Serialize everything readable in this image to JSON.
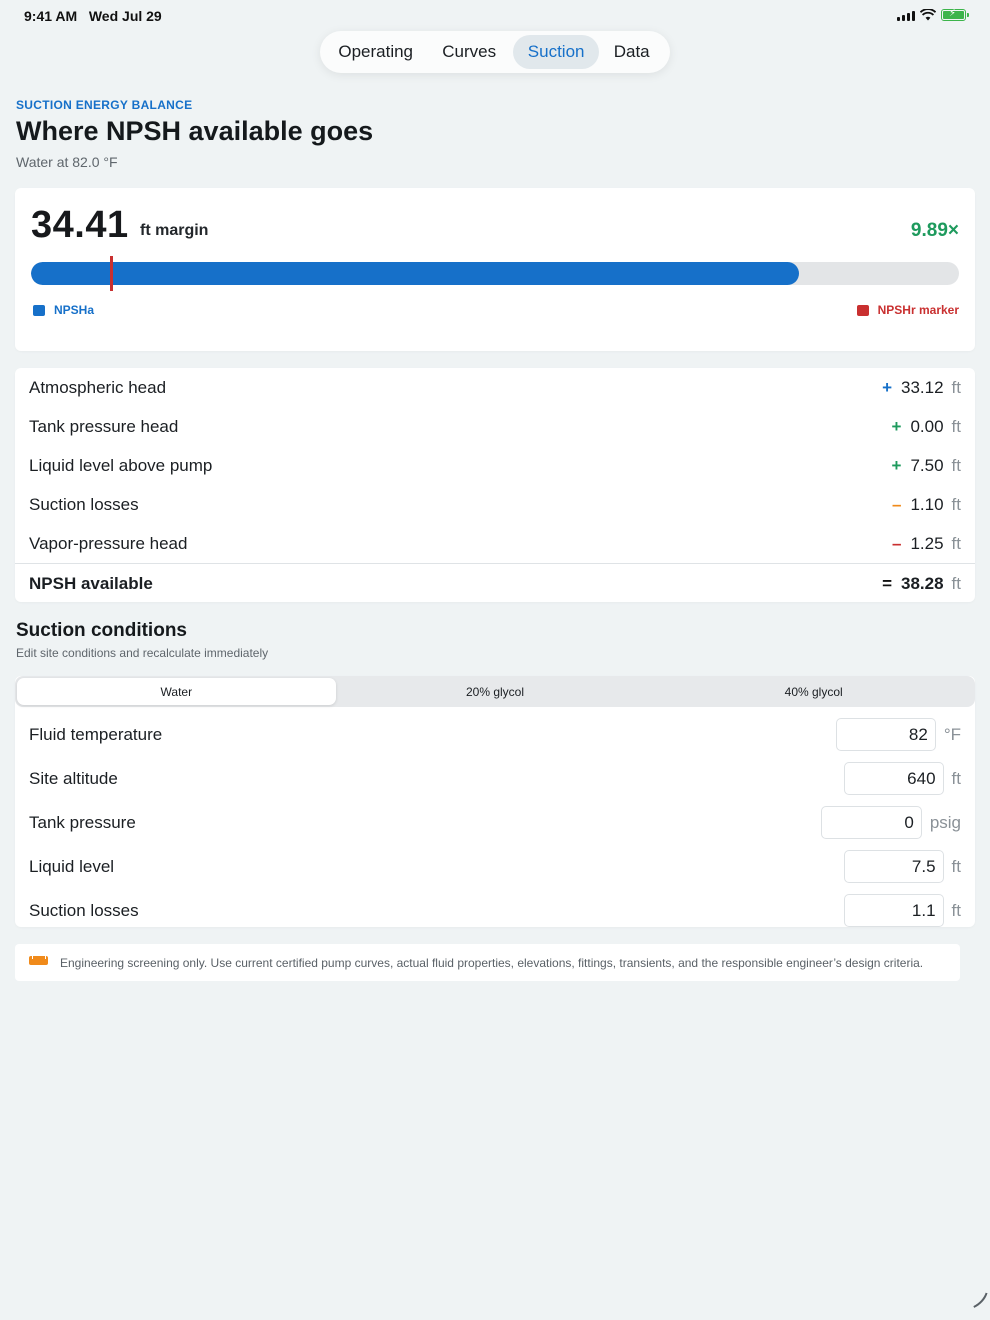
{
  "status_bar": {
    "time": "9:41 AM",
    "date": "Wed Jul 29",
    "battery_color": "#3cb44b"
  },
  "nav": {
    "tabs": [
      {
        "label": "Operating",
        "active": false
      },
      {
        "label": "Curves",
        "active": false
      },
      {
        "label": "Suction",
        "active": true
      },
      {
        "label": "Data",
        "active": false
      }
    ]
  },
  "header": {
    "eyebrow": "SUCTION ENERGY BALANCE",
    "title": "Where NPSH available goes",
    "subtitle": "Water at 82.0 °F"
  },
  "margin": {
    "value": "34.41",
    "unit": "ft margin",
    "ratio": "9.89×",
    "npsha_fraction": 0.828,
    "npshr_marker_fraction": 0.085,
    "legend_npsha": "NPSHa",
    "legend_npshr": "NPSHr marker",
    "colors": {
      "npsha": "#1670c9",
      "npshr": "#c93030",
      "ratio": "#1e9a5d"
    }
  },
  "balance": {
    "rows": [
      {
        "label": "Atmospheric head",
        "sign": "+",
        "sign_color": "#1670c9",
        "value": "33.12",
        "unit": "ft"
      },
      {
        "label": "Tank pressure head",
        "sign": "+",
        "sign_color": "#1e9a5d",
        "value": "0.00",
        "unit": "ft"
      },
      {
        "label": "Liquid level above pump",
        "sign": "+",
        "sign_color": "#1e9a5d",
        "value": "7.50",
        "unit": "ft"
      },
      {
        "label": "Suction losses",
        "sign": "–",
        "sign_color": "#f08a1a",
        "value": "1.10",
        "unit": "ft"
      },
      {
        "label": "Vapor-pressure head",
        "sign": "–",
        "sign_color": "#c93030",
        "value": "1.25",
        "unit": "ft"
      }
    ],
    "total": {
      "label": "NPSH available",
      "sign": "=",
      "value": "38.28",
      "unit": "ft"
    }
  },
  "conditions": {
    "title": "Suction conditions",
    "subtitle": "Edit site conditions and recalculate immediately",
    "fluids": [
      {
        "label": "Water",
        "active": true
      },
      {
        "label": "20% glycol",
        "active": false
      },
      {
        "label": "40% glycol",
        "active": false
      }
    ],
    "fields": [
      {
        "label": "Fluid temperature",
        "value": "82",
        "unit": "°F"
      },
      {
        "label": "Site altitude",
        "value": "640",
        "unit": "ft"
      },
      {
        "label": "Tank pressure",
        "value": "0",
        "unit": "psig"
      },
      {
        "label": "Liquid level",
        "value": "7.5",
        "unit": "ft"
      },
      {
        "label": "Suction losses",
        "value": "1.1",
        "unit": "ft"
      }
    ]
  },
  "disclaimer": {
    "icon": "ruler-icon",
    "text": "Engineering screening only. Use current certified pump curves, actual fluid properties, elevations, fittings, transients, and the responsible engineer’s design criteria."
  }
}
